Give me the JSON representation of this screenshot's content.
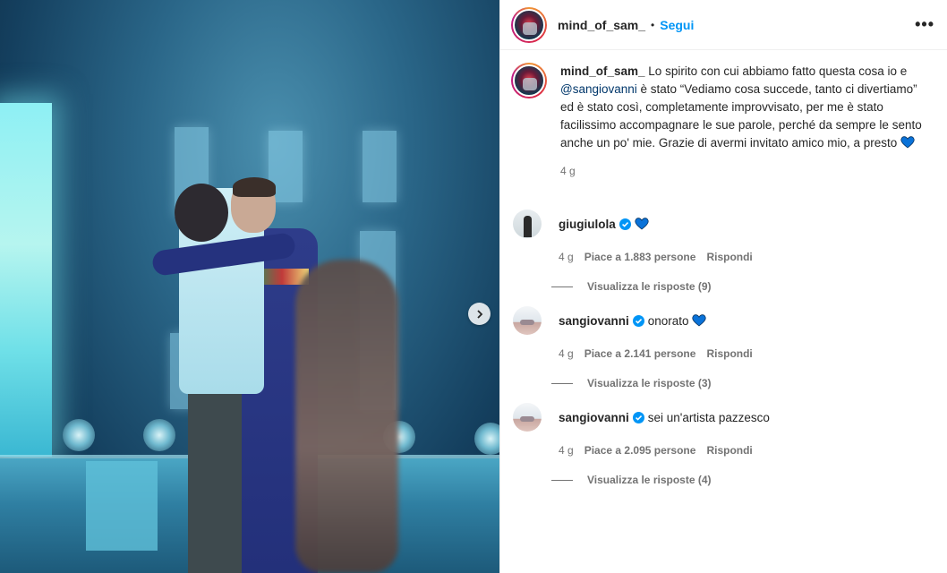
{
  "post": {
    "username": "mind_of_sam_",
    "separator": "•",
    "follow_label": "Segui",
    "more_label": "•••"
  },
  "caption": {
    "username": "mind_of_sam_",
    "text_before_mention": " Lo spirito con cui abbiamo fatto questa cosa io e ",
    "mention": "@sangiovanni",
    "text_after_mention": " è stato “Vediamo cosa succede, tanto ci divertiamo” ed è stato così, completamente improvvisato, per me è stato facilissimo accompagnare le sue parole, perché da sempre le sento anche un po' mie. Grazie di avermi invitato amico mio, a presto ",
    "time": "4 g"
  },
  "comments": [
    {
      "username": "giugiulola",
      "text": "",
      "emoji": "blue-heart-icon",
      "time": "4 g",
      "likes": "Piace a 1.883 persone",
      "reply": "Rispondi",
      "view_replies": "Visualizza le risposte (9)"
    },
    {
      "username": "sangiovanni",
      "text": "onorato",
      "emoji": "blue-heart-icon",
      "time": "4 g",
      "likes": "Piace a 2.141 persone",
      "reply": "Rispondi",
      "view_replies": "Visualizza le risposte (3)"
    },
    {
      "username": "sangiovanni",
      "text": "sei un'artista pazzesco",
      "emoji": "",
      "time": "4 g",
      "likes": "Piace a 2.095 persone",
      "reply": "Rispondi",
      "view_replies": "Visualizza le risposte (4)"
    }
  ],
  "colors": {
    "link": "#0095f6",
    "mention": "#00376b",
    "heart": "#0a72d8",
    "verified": "#0095f6",
    "muted": "#737373"
  }
}
